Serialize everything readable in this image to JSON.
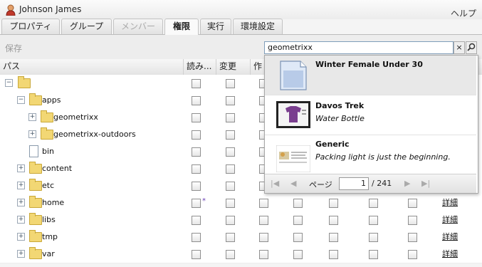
{
  "user": {
    "name": "Johnson James"
  },
  "help_label": "ヘルプ",
  "tabs": [
    {
      "label": "プロパティ",
      "state": "normal"
    },
    {
      "label": "グループ",
      "state": "normal"
    },
    {
      "label": "メンバー",
      "state": "disabled"
    },
    {
      "label": "権限",
      "state": "active"
    },
    {
      "label": "実行",
      "state": "normal"
    },
    {
      "label": "環境設定",
      "state": "normal"
    }
  ],
  "toolbar": {
    "save_label": "保存"
  },
  "search": {
    "value": "geometrixx",
    "clear_label": "×"
  },
  "grid": {
    "columns": [
      "パス",
      "読み...",
      "変更",
      "作"
    ],
    "detail_label": "詳細",
    "rows": [
      {
        "name": "",
        "type": "root"
      },
      {
        "name": "apps",
        "type": "folder"
      },
      {
        "name": "geometrixx",
        "type": "folder"
      },
      {
        "name": "geometrixx-outdoors",
        "type": "folder"
      },
      {
        "name": "bin",
        "type": "page"
      },
      {
        "name": "content",
        "type": "folder"
      },
      {
        "name": "etc",
        "type": "folder"
      },
      {
        "name": "home",
        "type": "folder"
      },
      {
        "name": "libs",
        "type": "folder"
      },
      {
        "name": "tmp",
        "type": "folder"
      },
      {
        "name": "var",
        "type": "folder"
      }
    ],
    "asterisk": "*"
  },
  "popup": {
    "results": [
      {
        "title": "Winter Female Under 30",
        "subtitle": "",
        "thumb": "page-icon"
      },
      {
        "title": "Davos Trek",
        "subtitle": "Water Bottle",
        "thumb": "shirt-icon"
      },
      {
        "title": "Generic",
        "subtitle": "Packing light is just the beginning.",
        "thumb": "article-icon"
      }
    ],
    "pager": {
      "page_label": "ページ",
      "current": "1",
      "total": "/  241"
    }
  }
}
